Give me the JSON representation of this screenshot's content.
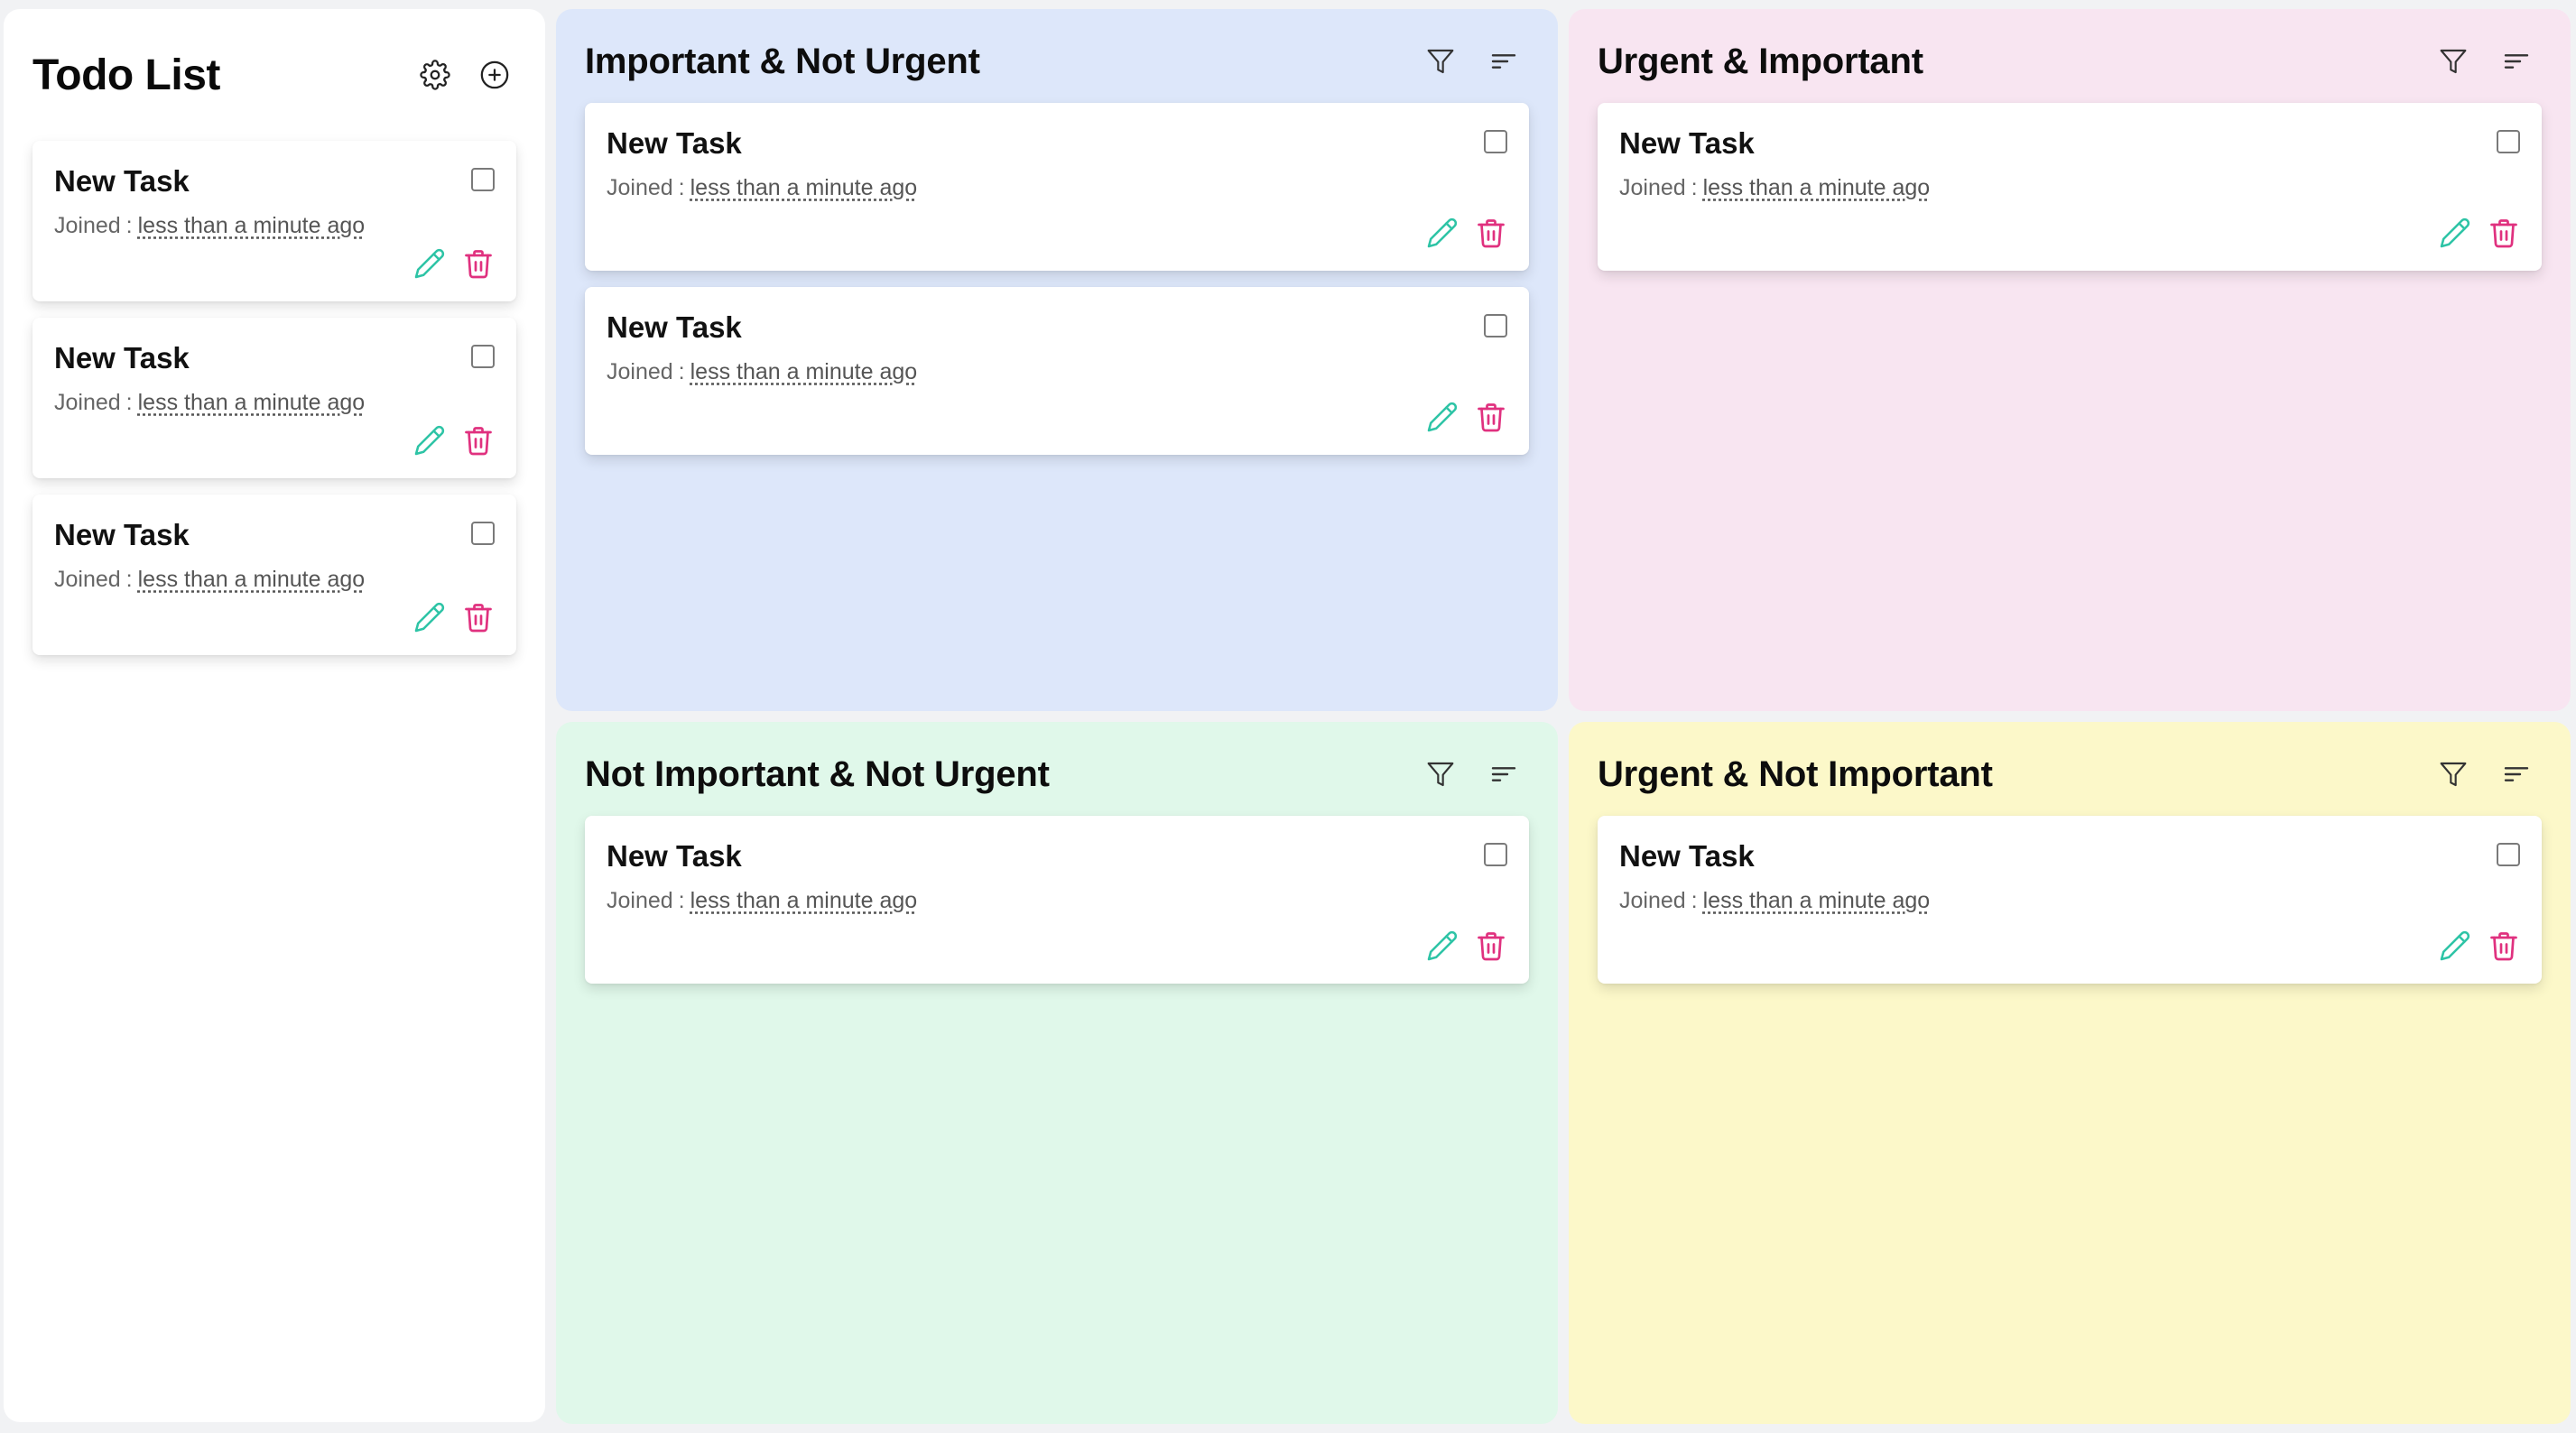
{
  "sidebar": {
    "title": "Todo List",
    "icons": {
      "settings": "gear-icon",
      "add": "plus-circle-icon"
    },
    "tasks": [
      {
        "title": "New Task",
        "meta_label": "Joined",
        "separator": ":",
        "relative_time": "less than a minute ago"
      },
      {
        "title": "New Task",
        "meta_label": "Joined",
        "separator": ":",
        "relative_time": "less than a minute ago"
      },
      {
        "title": "New Task",
        "meta_label": "Joined",
        "separator": ":",
        "relative_time": "less than a minute ago"
      }
    ]
  },
  "quadrants": {
    "important_not_urgent": {
      "title": "Important & Not Urgent",
      "background": "#dde7fa",
      "tasks": [
        {
          "title": "New Task",
          "meta_label": "Joined",
          "separator": ":",
          "relative_time": "less than a minute ago"
        },
        {
          "title": "New Task",
          "meta_label": "Joined",
          "separator": ":",
          "relative_time": "less than a minute ago"
        }
      ]
    },
    "urgent_important": {
      "title": "Urgent & Important",
      "background": "#f8e5f1",
      "tasks": [
        {
          "title": "New Task",
          "meta_label": "Joined",
          "separator": ":",
          "relative_time": "less than a minute ago"
        }
      ]
    },
    "not_important_not_urgent": {
      "title": "Not Important & Not Urgent",
      "background": "#e0f8ea",
      "tasks": [
        {
          "title": "New Task",
          "meta_label": "Joined",
          "separator": ":",
          "relative_time": "less than a minute ago"
        }
      ]
    },
    "urgent_not_important": {
      "title": "Urgent & Not Important",
      "background": "#fcf8c9",
      "tasks": [
        {
          "title": "New Task",
          "meta_label": "Joined",
          "separator": ":",
          "relative_time": "less than a minute ago"
        }
      ]
    }
  },
  "quadrant_icons": {
    "filter": "filter-icon",
    "sort": "sort-icon"
  },
  "task_icons": {
    "edit": "pencil-icon",
    "delete": "trash-icon"
  },
  "colors": {
    "edit_icon": "#2ec4a6",
    "delete_icon": "#e0317f"
  }
}
